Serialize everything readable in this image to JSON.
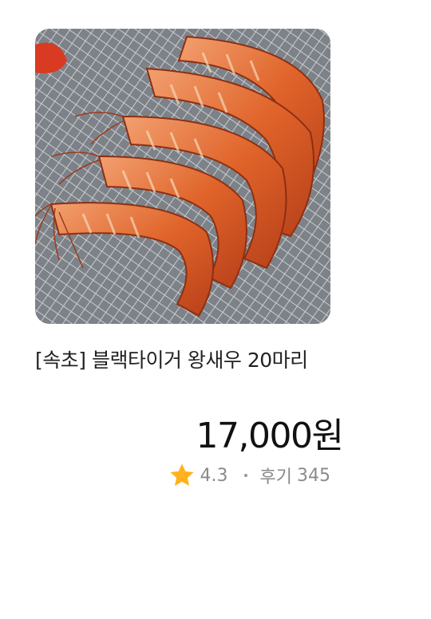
{
  "product": {
    "image_alt": "shrimp-photo",
    "title": "[속초] 블랙타이거 왕새우 20마리",
    "price": {
      "amount": "17,000",
      "unit": "원"
    },
    "rating": {
      "icon": "star-icon",
      "value": "4.3"
    },
    "reviews": {
      "label": "후기",
      "count": "345"
    }
  },
  "colors": {
    "star": "#FFB21D",
    "title": "#222222",
    "meta": "#8A8A8A",
    "shrimp": "#E0642A"
  }
}
